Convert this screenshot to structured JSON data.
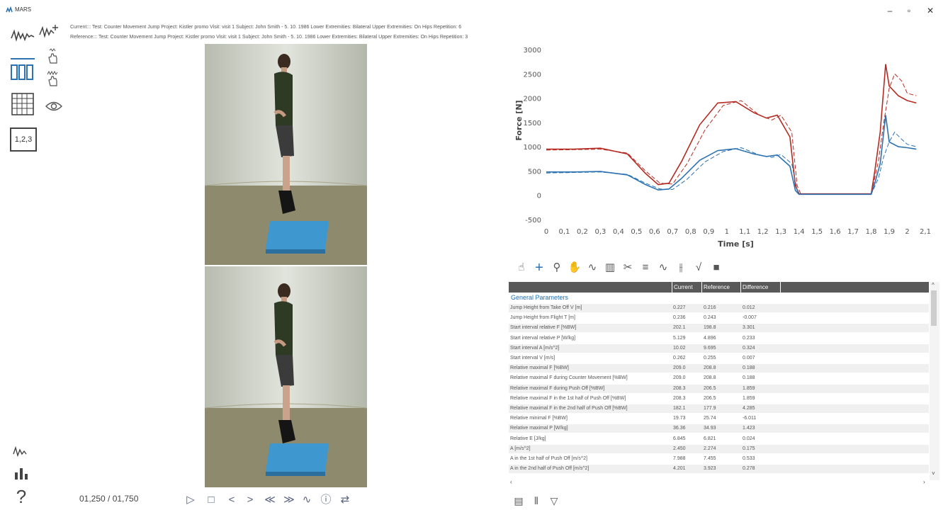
{
  "window": {
    "title": "MARS",
    "minimize": "–",
    "maximize": "▫",
    "close": "✕"
  },
  "info": {
    "current": "Current::: Test: Counter Movement Jump   Project: Kistler promo   Visit: visit 1   Subject: John Smith - 5. 10. 1986   Lower Extremities: Bilateral   Upper Extremities: On Hips   Repetition: 6",
    "reference": "Reference::: Test: Counter Movement Jump   Project: Kistler promo   Visit: visit 1   Subject: John Smith - 5. 10. 1986   Lower Extremities: Bilateral   Upper Extremities: On Hips   Repetition: 3"
  },
  "left_tools": [
    "signal-icon",
    "add-signal-icon",
    "single-touch-icon",
    "multi-touch-icon",
    "bars-icon",
    "table-icon",
    "eye-icon",
    "numbers-icon"
  ],
  "numbers_label": "1,2,3",
  "help_label": "?",
  "playback": {
    "counter": "01,250 / 01,750",
    "buttons": [
      {
        "icon": "play-icon",
        "glyph": "▷"
      },
      {
        "icon": "stop-icon",
        "glyph": "□"
      },
      {
        "icon": "prev-frame-icon",
        "glyph": "<"
      },
      {
        "icon": "next-frame-icon",
        "glyph": ">"
      },
      {
        "icon": "rewind-icon",
        "glyph": "≪"
      },
      {
        "icon": "fast-forward-icon",
        "glyph": "≫"
      },
      {
        "icon": "signal-sync-icon",
        "glyph": "∿"
      },
      {
        "icon": "info-icon",
        "glyph": "ⓘ"
      },
      {
        "icon": "video-swap-icon",
        "glyph": "⇄"
      }
    ]
  },
  "chart_toolbar": [
    {
      "icon": "multi-touch-icon",
      "glyph": "☝"
    },
    {
      "icon": "crosshair-icon",
      "glyph": "+"
    },
    {
      "icon": "zoom-icon",
      "glyph": "⚲"
    },
    {
      "icon": "pan-hand-icon",
      "glyph": "✋"
    },
    {
      "icon": "signal-icon",
      "glyph": "∿"
    },
    {
      "icon": "bar-chart-icon",
      "glyph": "▥"
    },
    {
      "icon": "scissors-icon",
      "glyph": "✂"
    },
    {
      "icon": "list-icon",
      "glyph": "≡"
    },
    {
      "icon": "filter-signal-icon",
      "glyph": "∿"
    },
    {
      "icon": "cursor-split-icon",
      "glyph": "⫲"
    },
    {
      "icon": "check-signal-icon",
      "glyph": "√"
    },
    {
      "icon": "camera-icon",
      "glyph": "■"
    }
  ],
  "bottom_toolbar": [
    {
      "icon": "export-icon",
      "glyph": "▤"
    },
    {
      "icon": "adjust-icon",
      "glyph": "⫴"
    },
    {
      "icon": "filter-icon",
      "glyph": "▽"
    }
  ],
  "chart_data": {
    "type": "line",
    "xlabel": "Time [s]",
    "ylabel": "Force [N]",
    "xlim": [
      0,
      2.1
    ],
    "ylim": [
      -500,
      3000
    ],
    "x_ticks": [
      "0",
      "0,1",
      "0,2",
      "0,3",
      "0,4",
      "0,5",
      "0,6",
      "0,7",
      "0,8",
      "0,9",
      "1",
      "1,1",
      "1,2",
      "1,3",
      "1,4",
      "1,5",
      "1,6",
      "1,7",
      "1,8",
      "1,9",
      "2",
      "2,1"
    ],
    "y_ticks": [
      "3000",
      "2500",
      "2000",
      "1500",
      "1000",
      "500",
      "0",
      "-500"
    ],
    "series": [
      {
        "color": "#b52b22",
        "dashed": false,
        "x": [
          0,
          0.15,
          0.3,
          0.45,
          0.55,
          0.62,
          0.68,
          0.75,
          0.85,
          0.95,
          1.05,
          1.15,
          1.22,
          1.28,
          1.35,
          1.38,
          1.4,
          1.5,
          1.6,
          1.7,
          1.8,
          1.82,
          1.85,
          1.88,
          1.9,
          1.95,
          2.0,
          2.05
        ],
        "y": [
          950,
          950,
          970,
          850,
          450,
          220,
          250,
          700,
          1450,
          1900,
          1930,
          1700,
          1590,
          1650,
          1200,
          200,
          30,
          30,
          30,
          30,
          30,
          500,
          1300,
          2700,
          2250,
          2050,
          1950,
          1900
        ]
      },
      {
        "color": "#b52b22",
        "dashed": true,
        "x": [
          0,
          0.15,
          0.3,
          0.45,
          0.55,
          0.63,
          0.7,
          0.78,
          0.88,
          0.98,
          1.08,
          1.18,
          1.25,
          1.3,
          1.36,
          1.39,
          1.41,
          1.5,
          1.6,
          1.7,
          1.8,
          1.84,
          1.87,
          1.9,
          1.93,
          1.97,
          2.0,
          2.05
        ],
        "y": [
          930,
          940,
          950,
          870,
          500,
          250,
          230,
          650,
          1350,
          1850,
          1950,
          1650,
          1550,
          1650,
          1300,
          200,
          30,
          30,
          30,
          30,
          30,
          700,
          1500,
          2200,
          2500,
          2350,
          2100,
          2050
        ]
      },
      {
        "color": "#2c72b0",
        "dashed": false,
        "x": [
          0,
          0.15,
          0.3,
          0.45,
          0.55,
          0.62,
          0.68,
          0.75,
          0.85,
          0.95,
          1.05,
          1.15,
          1.22,
          1.28,
          1.35,
          1.38,
          1.4,
          1.5,
          1.6,
          1.7,
          1.8,
          1.82,
          1.85,
          1.88,
          1.9,
          1.95,
          2.0,
          2.05
        ],
        "y": [
          480,
          480,
          490,
          420,
          220,
          110,
          130,
          350,
          720,
          920,
          960,
          850,
          800,
          830,
          600,
          100,
          20,
          20,
          20,
          20,
          20,
          250,
          650,
          1650,
          1100,
          1000,
          980,
          950
        ]
      },
      {
        "color": "#2c72b0",
        "dashed": true,
        "x": [
          0,
          0.15,
          0.3,
          0.45,
          0.55,
          0.63,
          0.7,
          0.78,
          0.88,
          0.98,
          1.08,
          1.18,
          1.25,
          1.3,
          1.36,
          1.39,
          1.41,
          1.5,
          1.6,
          1.7,
          1.8,
          1.84,
          1.87,
          1.9,
          1.93,
          1.97,
          2.0,
          2.05
        ],
        "y": [
          460,
          470,
          480,
          430,
          250,
          130,
          120,
          330,
          690,
          900,
          980,
          830,
          780,
          840,
          650,
          100,
          20,
          20,
          20,
          20,
          20,
          350,
          800,
          1100,
          1300,
          1150,
          1050,
          1000
        ]
      }
    ]
  },
  "table": {
    "columns": [
      "Current",
      "Reference",
      "Difference"
    ],
    "group": "General Parameters",
    "rows": [
      [
        "Jump Height from Take Off V [m]",
        "0.227",
        "0.216",
        "0.012"
      ],
      [
        "Jump Height from Flight T [m]",
        "0.236",
        "0.243",
        "-0.007"
      ],
      [
        "Start interval relative F [%BW]",
        "202.1",
        "198.8",
        "3.301"
      ],
      [
        "Start interval relative P [W/kg]",
        "5.129",
        "4.896",
        "0.233"
      ],
      [
        "Start interval A [m/s^2]",
        "10.02",
        "9.695",
        "0.324"
      ],
      [
        "Start interval V [m/s]",
        "0.262",
        "0.255",
        "0.007"
      ],
      [
        "Relative maximal F [%BW]",
        "209.0",
        "208.8",
        "0.188"
      ],
      [
        "Relative maximal F during Counter Movement [%BW]",
        "209.0",
        "208.8",
        "0.188"
      ],
      [
        "Relative maximal F during Push Off [%BW]",
        "208.3",
        "206.5",
        "1.859"
      ],
      [
        "Relative maximal F in the 1st half of Push Off [%BW]",
        "208.3",
        "206.5",
        "1.859"
      ],
      [
        "Relative maximal F in the 2nd half of Push Off [%BW]",
        "182.1",
        "177.9",
        "4.285"
      ],
      [
        "Relative minimal F [%BW]",
        "19.73",
        "25.74",
        "-6.011"
      ],
      [
        "Relative maximal P [W/kg]",
        "36.36",
        "34.93",
        "1.423"
      ],
      [
        "Relative E [J/kg]",
        "6.845",
        "6.821",
        "0.024"
      ],
      [
        "A [m/s^2]",
        "2.450",
        "2.274",
        "0.175"
      ],
      [
        "A in the 1st half of Push Off [m/s^2]",
        "7.988",
        "7.455",
        "0.533"
      ],
      [
        "A in the 2nd half of Push Off [m/s^2]",
        "4.201",
        "3.923",
        "0.278"
      ]
    ]
  }
}
